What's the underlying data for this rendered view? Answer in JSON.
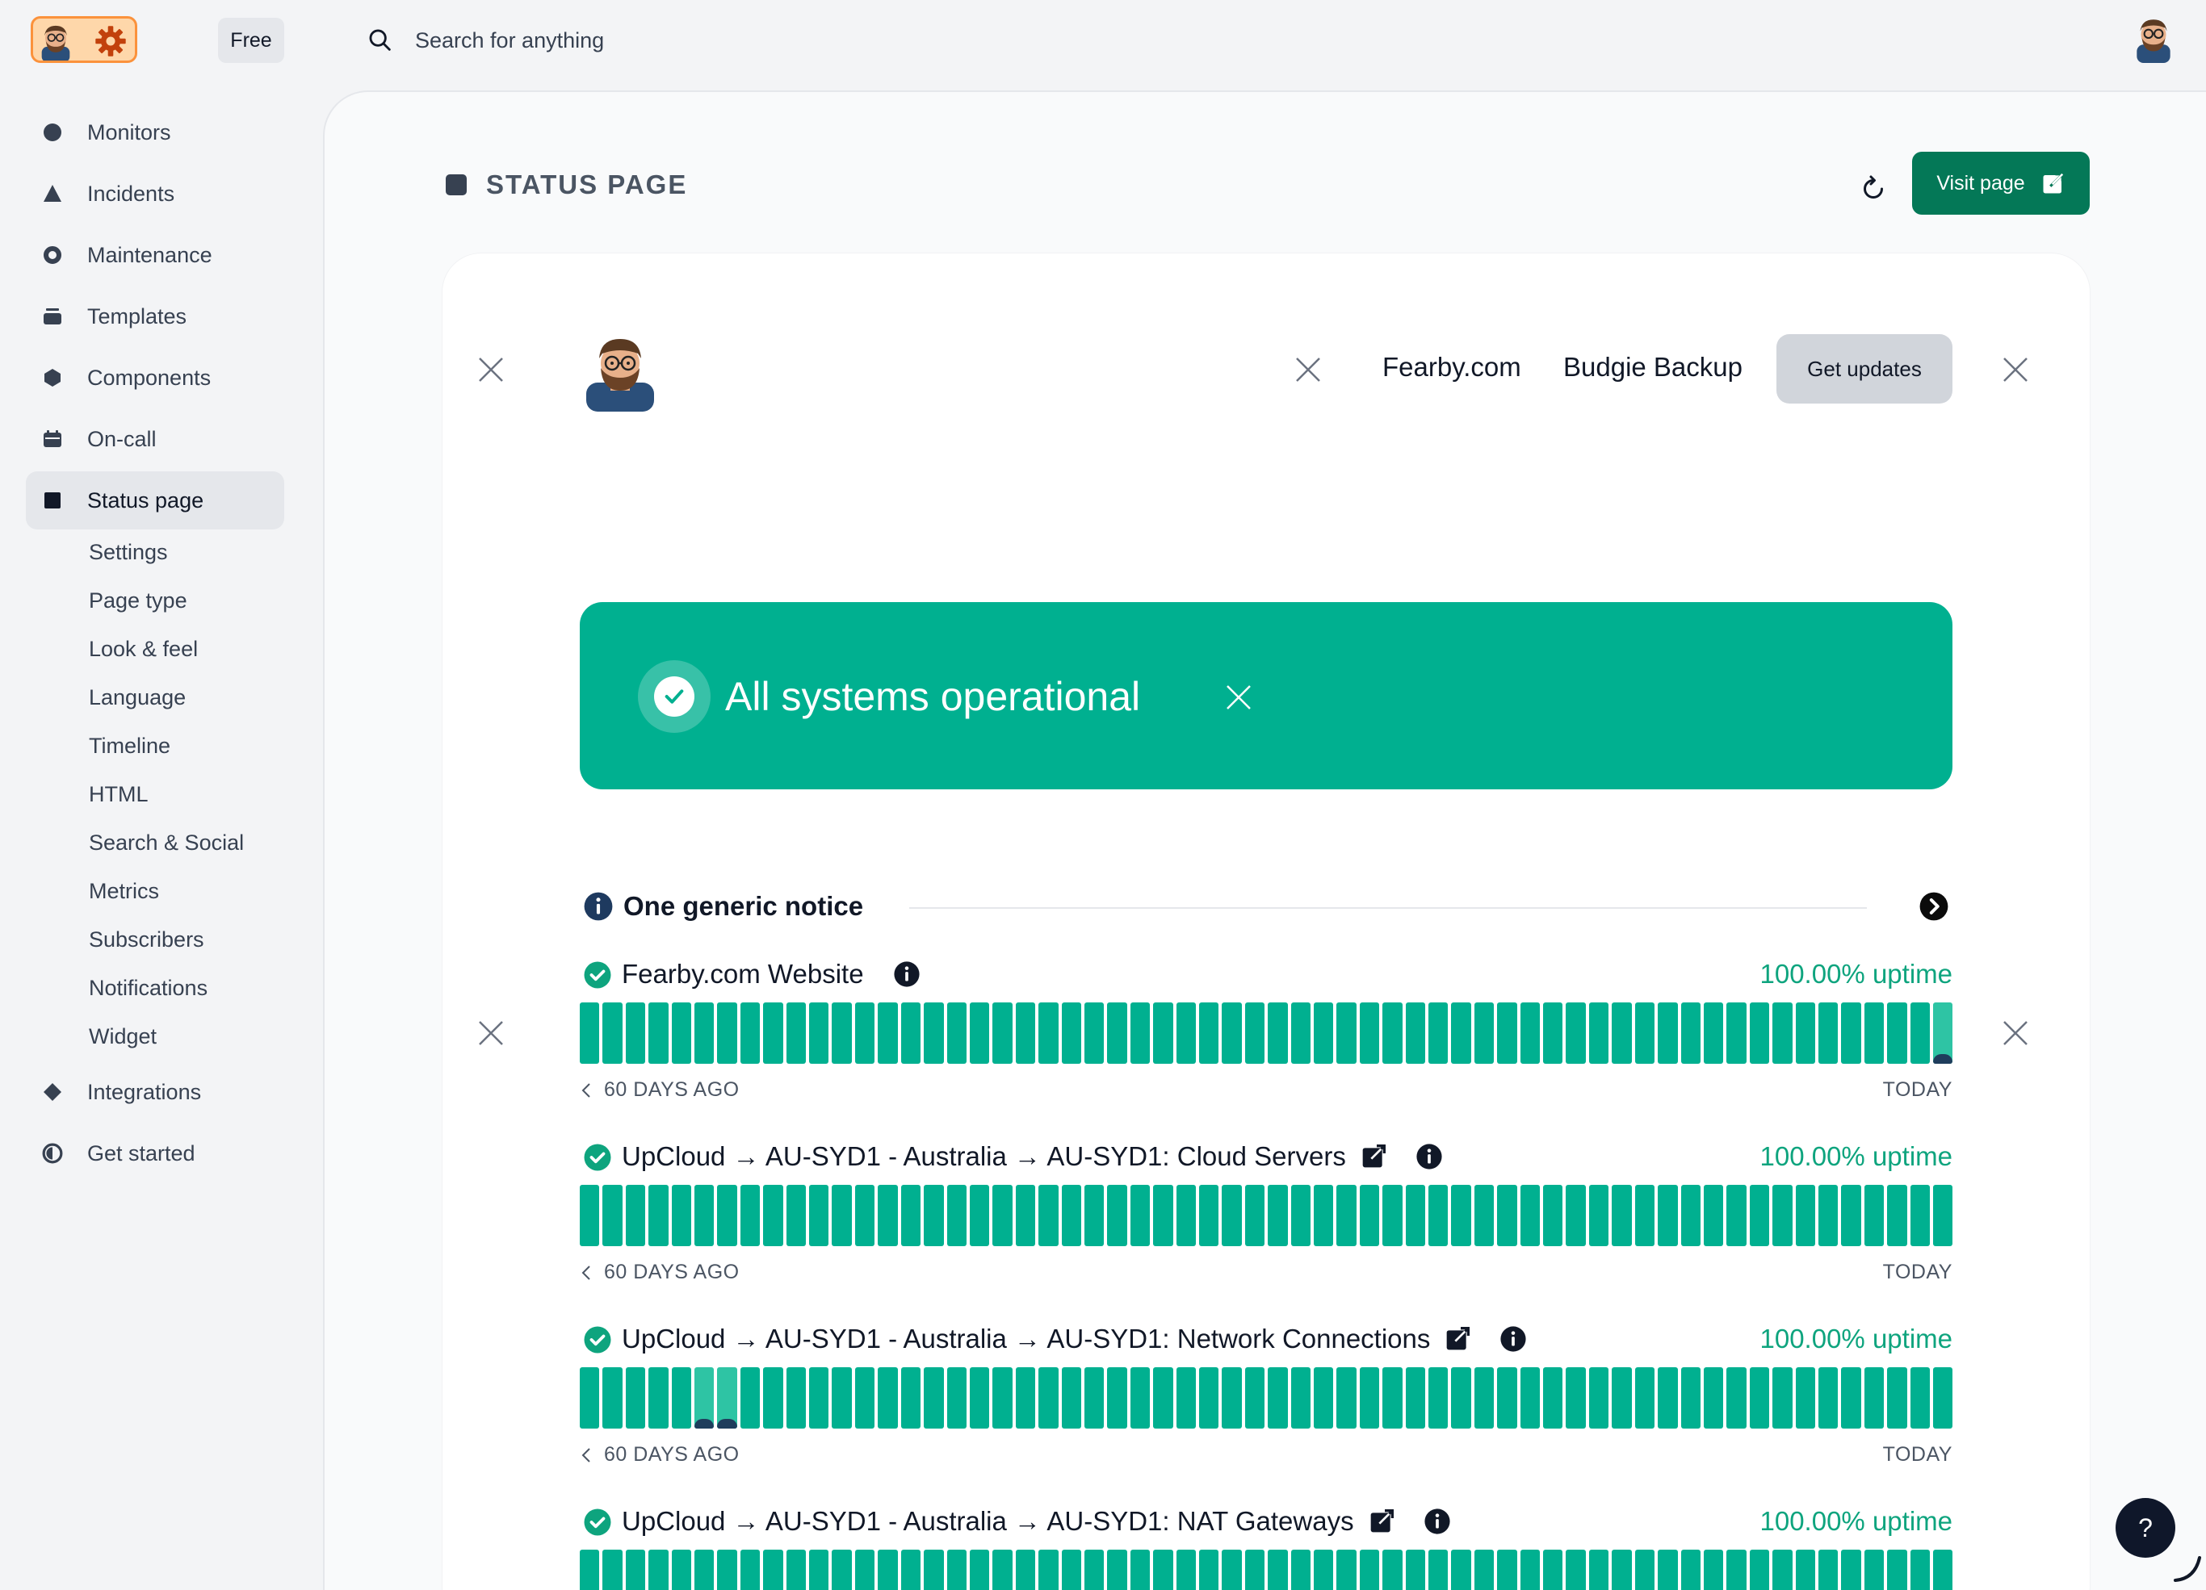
{
  "topbar": {
    "plan_badge": "Free",
    "search_placeholder": "Search for anything"
  },
  "sidebar": {
    "items": [
      {
        "label": "Monitors",
        "icon": "circle-icon"
      },
      {
        "label": "Incidents",
        "icon": "triangle-icon"
      },
      {
        "label": "Maintenance",
        "icon": "ring-icon"
      },
      {
        "label": "Templates",
        "icon": "stack-icon"
      },
      {
        "label": "Components",
        "icon": "hexagon-icon"
      },
      {
        "label": "On-call",
        "icon": "calendar-icon"
      },
      {
        "label": "Status page",
        "icon": "square-icon",
        "active": true
      },
      {
        "label": "Integrations",
        "icon": "diamond-icon"
      },
      {
        "label": "Get started",
        "icon": "half-circle-icon"
      }
    ],
    "status_subitems": [
      "Settings",
      "Page type",
      "Look & feel",
      "Language",
      "Timeline",
      "HTML",
      "Search & Social",
      "Metrics",
      "Subscribers",
      "Notifications",
      "Widget"
    ]
  },
  "main": {
    "heading": "STATUS PAGE",
    "visit_label": "Visit page"
  },
  "preview": {
    "nav_links": [
      "Fearby.com",
      "Budgie Backup"
    ],
    "get_updates": "Get updates",
    "status_text": "All systems operational",
    "notice_title": "One generic notice",
    "axis_start": "60 DAYS AGO",
    "axis_end": "TODAY",
    "monitors": [
      {
        "name": "Fearby.com Website",
        "uptime": "100.00% uptime",
        "external": false,
        "days": 60,
        "incident_days": [
          59
        ]
      },
      {
        "name": "UpCloud → AU-SYD1 - Australia → AU-SYD1: Cloud Servers",
        "uptime": "100.00% uptime",
        "external": true,
        "days": 60,
        "incident_days": []
      },
      {
        "name": "UpCloud → AU-SYD1 - Australia → AU-SYD1: Network Connections",
        "uptime": "100.00% uptime",
        "external": true,
        "days": 60,
        "incident_days": [
          5,
          6
        ]
      },
      {
        "name": "UpCloud → AU-SYD1 - Australia → AU-SYD1: NAT Gateways",
        "uptime": "100.00% uptime",
        "external": true,
        "days": 60,
        "incident_days": []
      }
    ]
  },
  "help_label": "?",
  "colors": {
    "accent": "#047857",
    "operational": "#00b090",
    "incident_marker": "#1f3d5c"
  }
}
